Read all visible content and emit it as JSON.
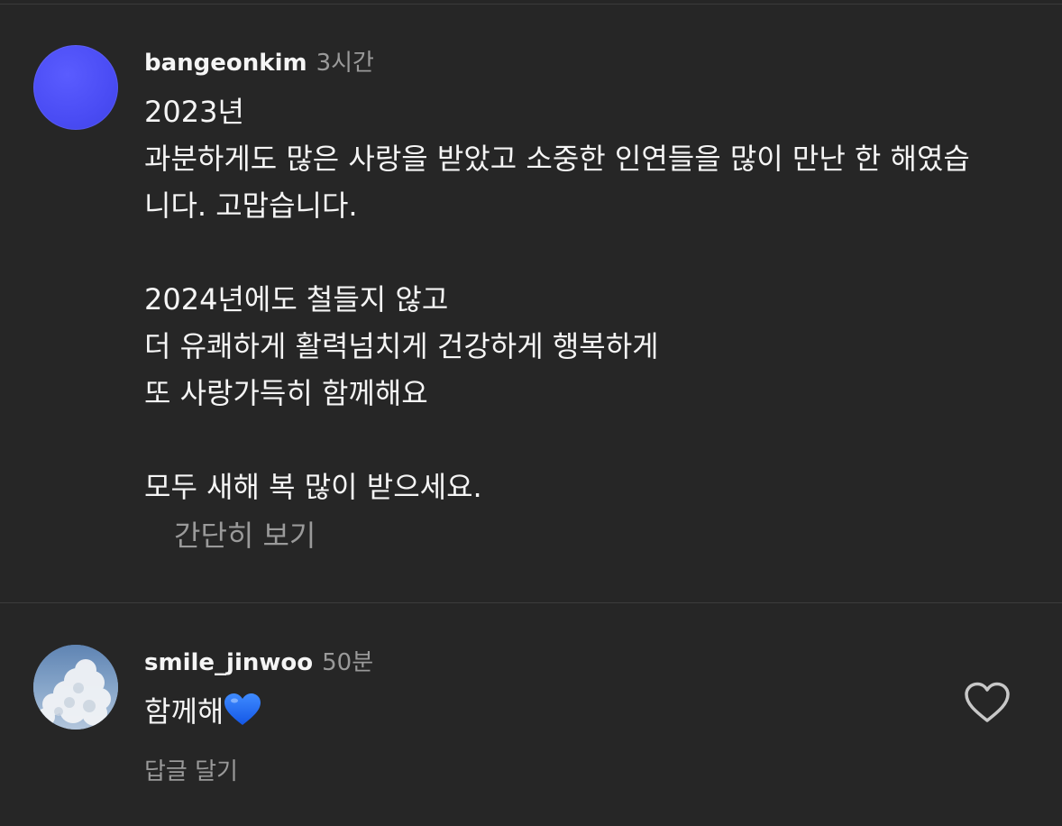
{
  "comments": [
    {
      "username": "bangeonkim",
      "timestamp": "3시간",
      "lines": [
        "2023년",
        "과분하게도 많은 사랑을 받았고 소중한 인연들을 많이 만난 한 해였습",
        "니다. 고맙습니다.",
        "",
        "2024년에도 철들지 않고",
        "더 유쾌하게 활력넘치게 건강하게 행복하게",
        "또 사랑가득히 함께해요",
        "",
        "모두 새해 복 많이 받으세요."
      ],
      "collapse_label": "간단히 보기",
      "avatar_color": "#4a4cf4"
    },
    {
      "username": "smile_jinwoo",
      "timestamp": "50분",
      "text": "함께해",
      "emoji": "blue-heart",
      "reply_label": "답글 달기",
      "emoji_color": "#1d6cff"
    }
  ],
  "colors": {
    "background": "#262626",
    "text": "#f5f5f5",
    "muted": "#9a9a9a",
    "divider": "#3c3c3c"
  }
}
